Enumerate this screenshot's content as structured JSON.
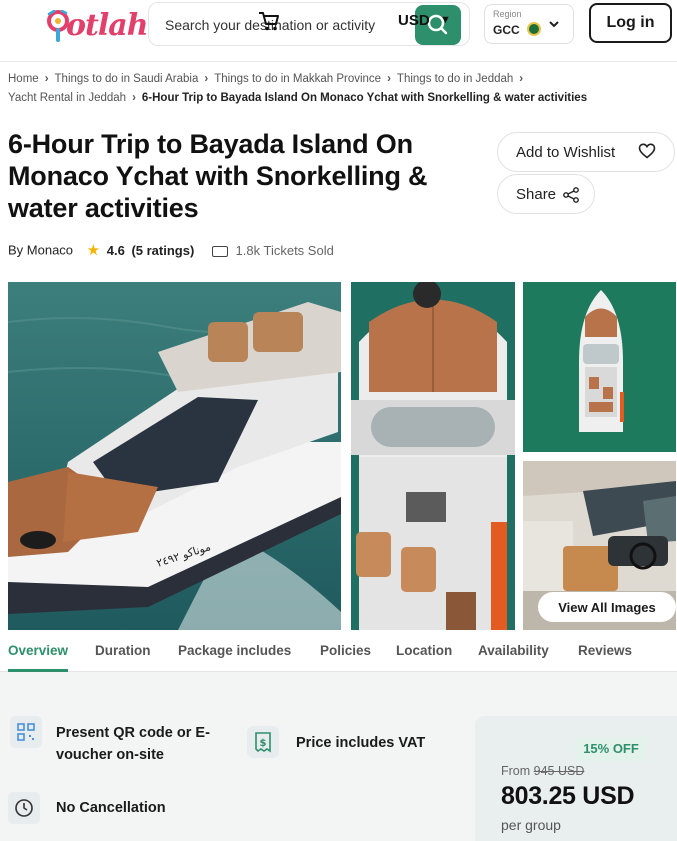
{
  "brand": {
    "name": "otlah",
    "color": "#e2406b",
    "accent": "#2d8f6b"
  },
  "header": {
    "search_placeholder": "Search your destination or activity",
    "currency": "USD",
    "region_label": "Region",
    "region_value": "GCC",
    "login_label": "Log in"
  },
  "breadcrumb": {
    "items": [
      "Home",
      "Things to do in Saudi Arabia",
      "Things to do in Makkah Province",
      "Things to do in Jeddah",
      "Yacht Rental in Jeddah"
    ],
    "current": "6-Hour Trip to Bayada Island On Monaco Ychat with Snorkelling & water activities"
  },
  "product": {
    "title": "6-Hour Trip to Bayada Island On Monaco Ychat with Snorkelling & water activities",
    "vendor": "By Monaco",
    "rating": "4.6",
    "ratings_count": "(5 ratings)",
    "tickets_sold": "1.8k Tickets Sold"
  },
  "actions": {
    "wishlist_label": "Add to Wishlist",
    "share_label": "Share"
  },
  "gallery": {
    "view_all_label": "View All Images",
    "boat_registration": "موناكو ٢٤٩٢"
  },
  "tabs": [
    "Overview",
    "Duration",
    "Package includes",
    "Policies",
    "Location",
    "Availability",
    "Reviews"
  ],
  "active_tab": "Overview",
  "info": {
    "qr_text": "Present QR code or E-voucher on-site",
    "vat_text": "Price includes VAT",
    "cancel_text": "No Cancellation"
  },
  "price": {
    "discount": "15% OFF",
    "from_label": "From",
    "old_price": "945 USD",
    "current": "803.25 USD",
    "unit": "per group"
  },
  "icons": [
    "logo-pin-icon",
    "cart-icon",
    "search-icon",
    "chevron-down-icon",
    "flag-icon",
    "heart-icon",
    "share-icon",
    "star-icon",
    "ticket-icon",
    "qr-icon",
    "receipt-icon",
    "clock-icon"
  ]
}
